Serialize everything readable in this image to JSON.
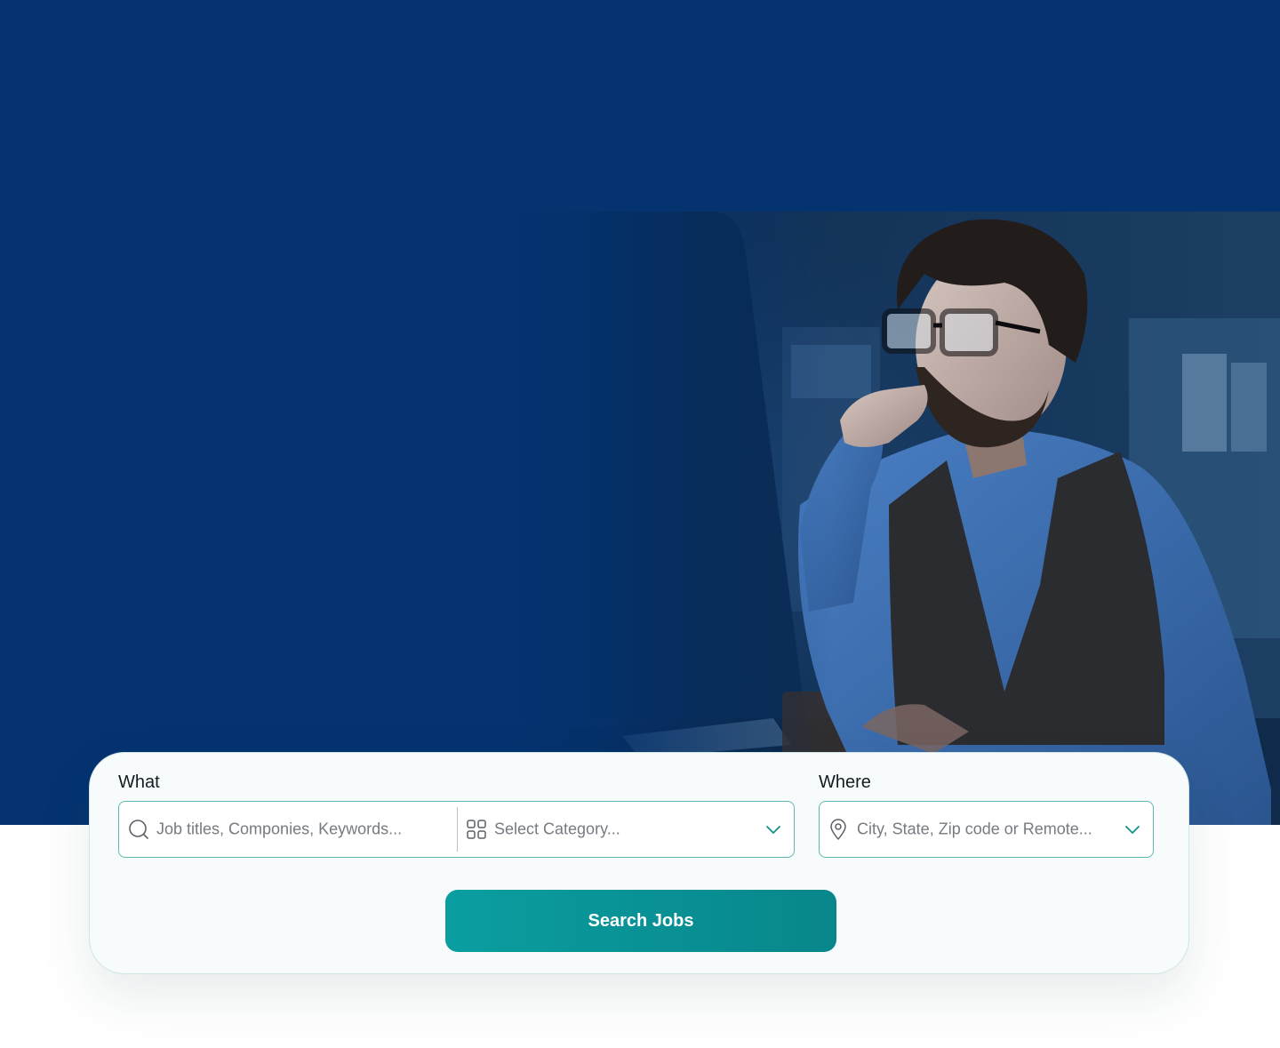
{
  "hero": {
    "background_color": "#043370",
    "photo": {
      "subject": "man-with-glasses-at-computer-image"
    }
  },
  "search": {
    "what_label": "What",
    "where_label": "Where",
    "keywords_placeholder": "Job titles, Componies, Keywords...",
    "category_placeholder": "Select Category...",
    "location_placeholder": "City, State, Zip code or Remote...",
    "button_label": "Search Jobs",
    "accent_color": "#0a9ea0",
    "icons": {
      "keywords": "search-icon",
      "category": "grid-icon",
      "category_dropdown": "chevron-down-icon",
      "location": "location-pin-icon",
      "location_dropdown": "chevron-down-icon"
    }
  }
}
